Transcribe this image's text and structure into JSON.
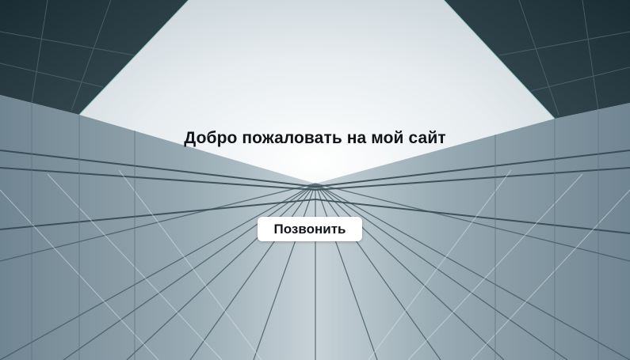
{
  "hero": {
    "title": "Добро пожаловать на мой сайт",
    "button_label": "Позвонить",
    "background_image": "skyscraper-glass-facade-looking-up"
  },
  "colors": {
    "sky": "#e8eef1",
    "glass": "#7e939e",
    "building_dark": "#22363d",
    "text": "#111418",
    "button_bg": "#ffffff"
  }
}
